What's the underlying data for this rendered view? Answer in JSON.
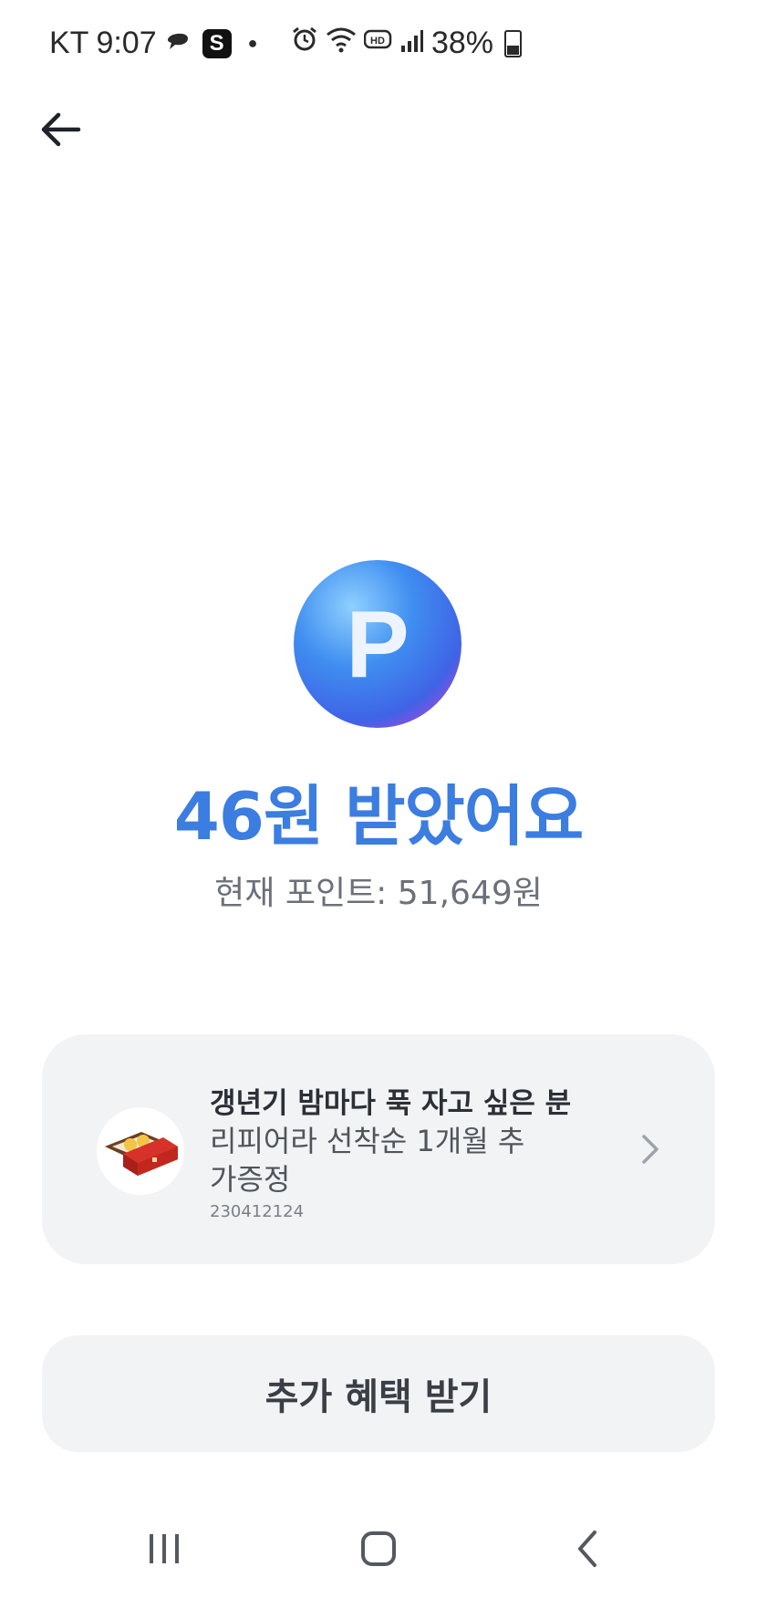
{
  "status_bar": {
    "carrier": "KT",
    "time": "9:07",
    "app_badge": "S",
    "battery": "38%",
    "icons": [
      "chat-icon",
      "s-app-icon",
      "alarm-icon",
      "wifi-icon",
      "hd-icon",
      "signal-icon",
      "battery-icon"
    ]
  },
  "header": {
    "back_icon": "arrow-left-icon"
  },
  "reward": {
    "coin_letter": "P",
    "headline": "46원 받았어요",
    "current_points": "현재 포인트: 51,649원"
  },
  "promo": {
    "title": "갱년기 밤마다 푹 자고 싶은 분",
    "description": "리피어라 선착순 1개월 추가증정",
    "code": "230412124",
    "thumb_icon": "product-box-icon",
    "chevron_icon": "chevron-right-icon"
  },
  "cta": {
    "label": "추가 혜택 받기"
  },
  "nav": {
    "icons": [
      "recent-apps-icon",
      "home-icon",
      "back-icon"
    ]
  },
  "colors": {
    "accent": "#3b7de0",
    "card_bg": "#f2f3f5",
    "coin_gradient": [
      "#6fb9ff",
      "#3c86ee",
      "#8a4fe0"
    ]
  }
}
